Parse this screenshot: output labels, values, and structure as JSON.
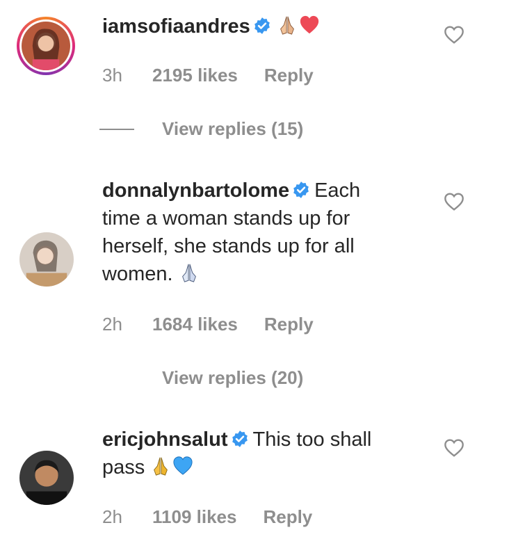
{
  "comments": [
    {
      "username": "iamsofiaandres",
      "text": "",
      "time": "3h",
      "likes": "2195 likes",
      "reply": "Reply",
      "view_replies": "View replies (15)"
    },
    {
      "username": "donnalynbartolome",
      "text_line1": "Each",
      "text_line2": "time a woman stands up for",
      "text_line3": "herself, she stands up for all",
      "text_line4": "women.",
      "time": "2h",
      "likes": "1684 likes",
      "reply": "Reply",
      "view_replies": "View replies (20)"
    },
    {
      "username": "ericjohnsalut",
      "text_line1": "This too shall",
      "text_line2": "pass",
      "time": "2h",
      "likes": "1109 likes",
      "reply": "Reply"
    }
  ],
  "colors": {
    "verified": "#3897f0",
    "red_heart": "#ed4956",
    "blue_heart": "#3da5f4",
    "meta_text": "#8e8e8e"
  },
  "icons": [
    "verified-badge-icon",
    "folded-hands-icon",
    "red-heart-icon",
    "blue-heart-icon",
    "like-heart-icon"
  ]
}
